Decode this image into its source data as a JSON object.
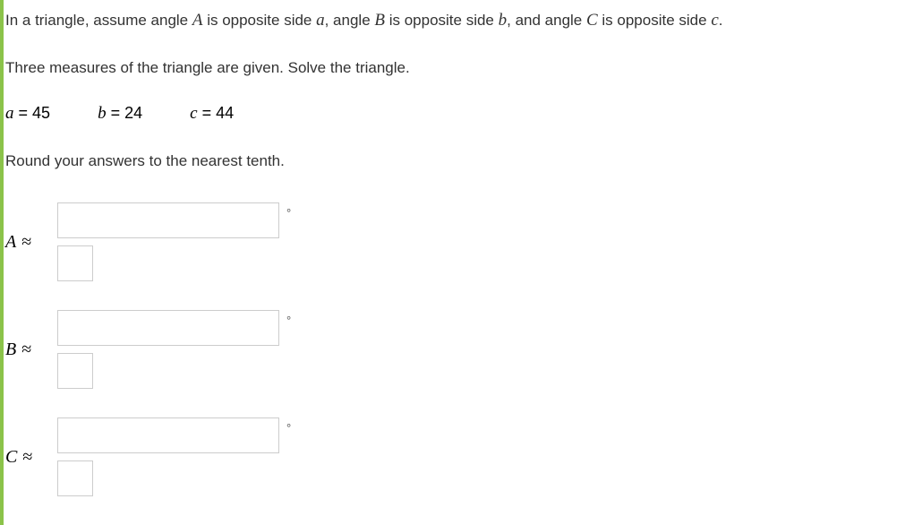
{
  "intro": {
    "pre_A": "In a triangle, assume angle ",
    "var_A": "A",
    "post_A": " is opposite side ",
    "var_a": "a",
    "mid1": ", angle ",
    "var_B": "B",
    "post_B": " is opposite side ",
    "var_b": "b",
    "mid2": ", and angle ",
    "var_C": "C",
    "post_C": " is opposite side ",
    "var_c": "c",
    "end": "."
  },
  "instruction": "Three measures of the triangle are given. Solve the triangle.",
  "given": {
    "a_var": "a",
    "a_eq": " = 45",
    "b_var": "b",
    "b_eq": " = 24",
    "c_var": "c",
    "c_eq": " = 44"
  },
  "round_text": "Round your answers to the nearest tenth.",
  "answers": {
    "A_label": "A",
    "B_label": "B",
    "C_label": "C",
    "approx": "≈"
  },
  "degree": "°"
}
